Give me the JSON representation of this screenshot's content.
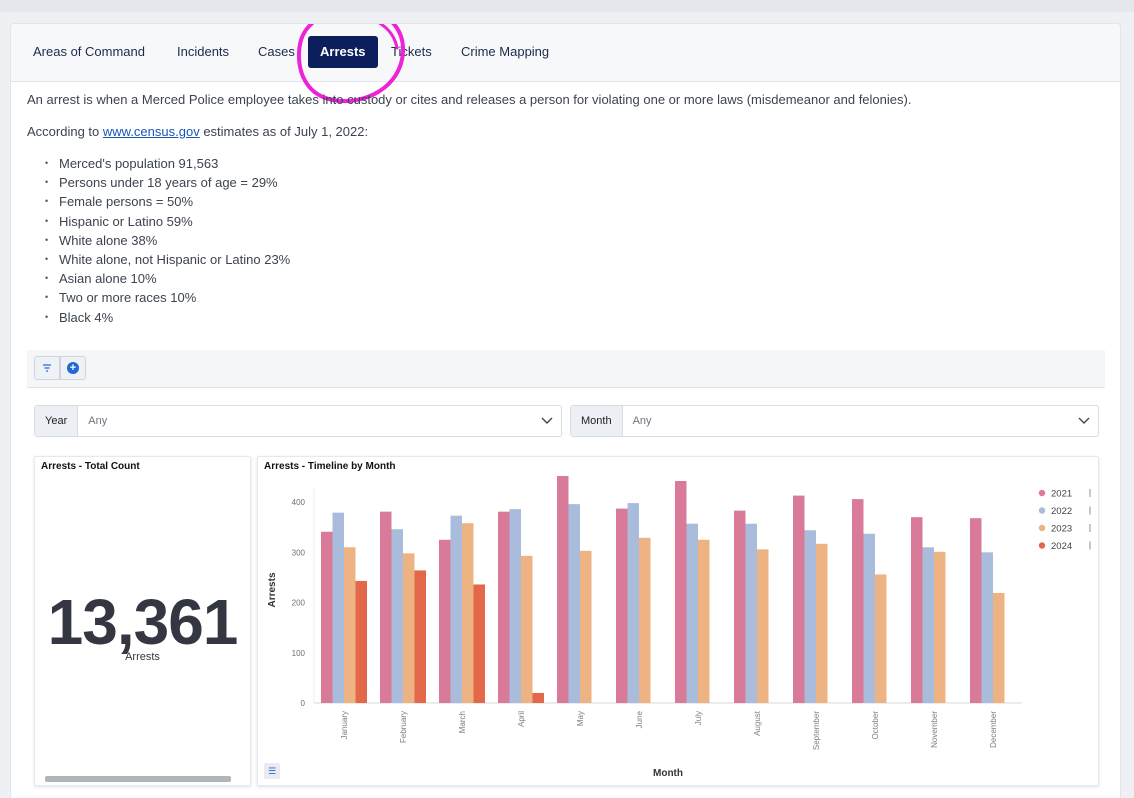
{
  "tabs": [
    {
      "label": "Areas of Command",
      "active": false
    },
    {
      "label": "Incidents",
      "active": false
    },
    {
      "label": "Cases",
      "active": false
    },
    {
      "label": "Arrests",
      "active": true
    },
    {
      "label": "Tickets",
      "active": false
    },
    {
      "label": "Crime Mapping",
      "active": false
    }
  ],
  "intro": {
    "paragraph": "An arrest is when a Merced Police employee takes into custody or cites and releases a person for violating one or more laws (misdemeanor and felonies).",
    "census_prefix": "According to ",
    "census_link": "www.census.gov",
    "census_suffix": " estimates as of July 1, 2022:",
    "facts": [
      "Merced's population 91,563",
      "Persons under 18 years of age = 29%",
      "Female persons = 50%",
      "Hispanic or Latino 59%",
      "White alone 38%",
      "White alone, not Hispanic or Latino 23%",
      "Asian alone 10%",
      "Two or more races 10%",
      "Black 4%"
    ]
  },
  "filters": {
    "year": {
      "label": "Year",
      "value": "Any"
    },
    "month": {
      "label": "Month",
      "value": "Any"
    }
  },
  "total_panel": {
    "title": "Arrests - Total Count",
    "value": "13,361",
    "label": "Arrests"
  },
  "timeline_panel": {
    "title": "Arrests - Timeline by Month"
  },
  "colors": {
    "accent": "#0c1f5c",
    "highlight": "#ee22d8",
    "link": "#1a56b8"
  },
  "chart_data": {
    "type": "bar",
    "title": "Arrests - Timeline by Month",
    "xlabel": "Month",
    "ylabel": "Arrests",
    "ylim": [
      0,
      450
    ],
    "yticks": [
      0,
      100,
      200,
      300,
      400
    ],
    "grid": false,
    "legend": "top-right",
    "categories": [
      "January",
      "February",
      "March",
      "April",
      "May",
      "June",
      "July",
      "August",
      "September",
      "October",
      "November",
      "December"
    ],
    "series": [
      {
        "name": "2021",
        "color": "#d97b98",
        "values": [
          341,
          381,
          325,
          381,
          452,
          387,
          442,
          383,
          413,
          406,
          370,
          368
        ]
      },
      {
        "name": "2022",
        "color": "#a9bcdc",
        "values": [
          379,
          346,
          373,
          386,
          396,
          398,
          357,
          357,
          344,
          337,
          310,
          300
        ]
      },
      {
        "name": "2023",
        "color": "#edb383",
        "values": [
          310,
          298,
          358,
          293,
          303,
          329,
          325,
          306,
          317,
          256,
          301,
          219
        ]
      },
      {
        "name": "2024",
        "color": "#e26849",
        "values": [
          243,
          264,
          236,
          20,
          null,
          null,
          null,
          null,
          null,
          null,
          null,
          null
        ]
      }
    ]
  }
}
